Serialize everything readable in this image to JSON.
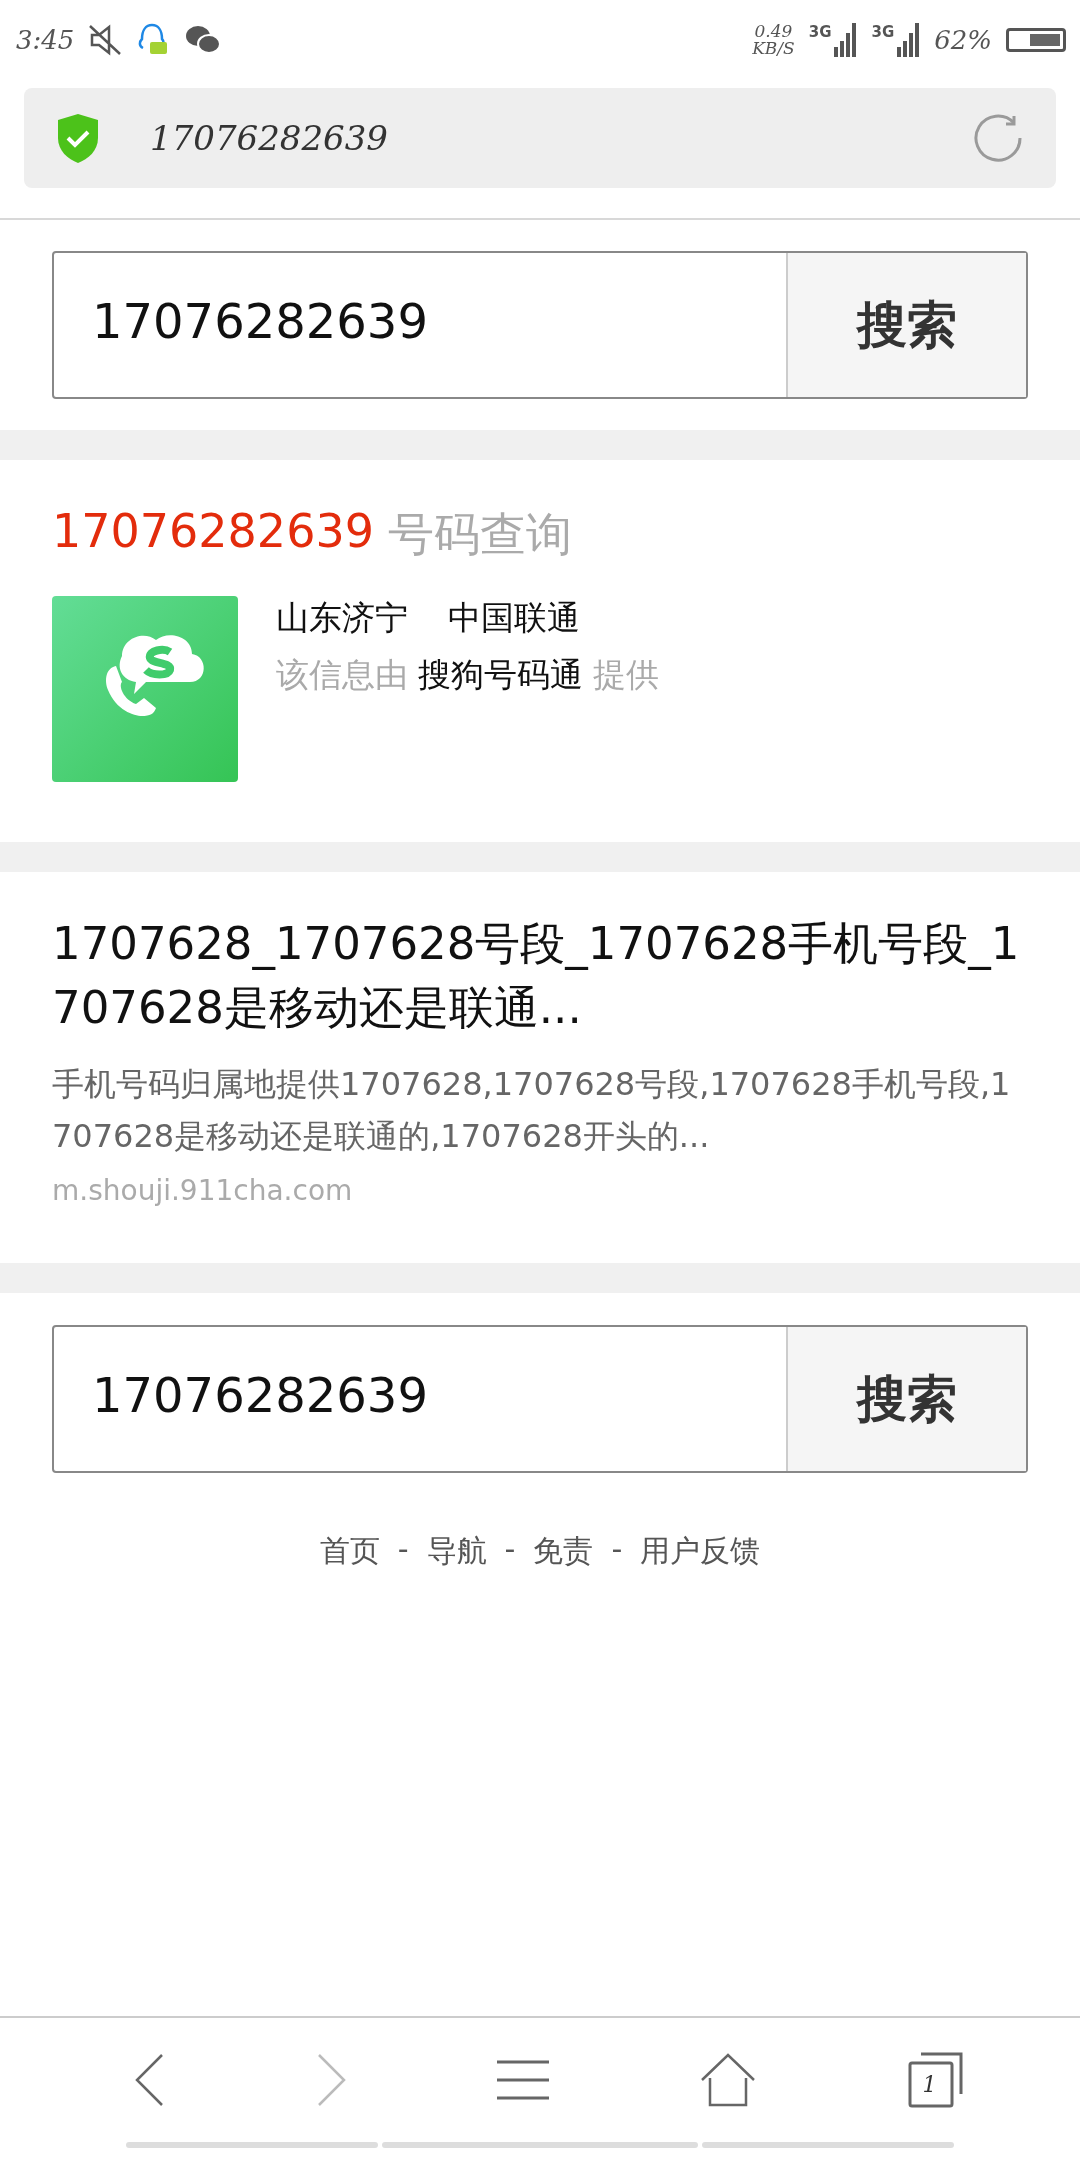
{
  "status_bar": {
    "time": "3:45",
    "speed": "0.49",
    "speed_unit": "KB/S",
    "networks": [
      "3G",
      "3G"
    ],
    "battery": "62%"
  },
  "address_bar": {
    "url": "17076282639"
  },
  "search_top": {
    "value": "17076282639",
    "button": "搜索"
  },
  "number_card": {
    "number": "17076282639",
    "title": "号码查询",
    "location": "山东济宁",
    "carrier": "中国联通",
    "source_prefix": "该信息由",
    "source": "搜狗号码通",
    "source_suffix": "提供"
  },
  "result": {
    "title": "1707628_1707628号段_1707628手机号段_1707628是移动还是联通...",
    "snippet": "手机号码归属地提供1707628,1707628号段,1707628手机号段,1707628是移动还是联通的,1707628开头的...",
    "url": "m.shouji.911cha.com"
  },
  "search_bottom": {
    "value": "17076282639",
    "button": "搜索"
  },
  "footer_links": [
    "首页",
    "导航",
    "免责",
    "用户反馈"
  ],
  "footer_separator": "-",
  "bottom_nav": {
    "tab_count": "1",
    "forward_disabled": true
  }
}
